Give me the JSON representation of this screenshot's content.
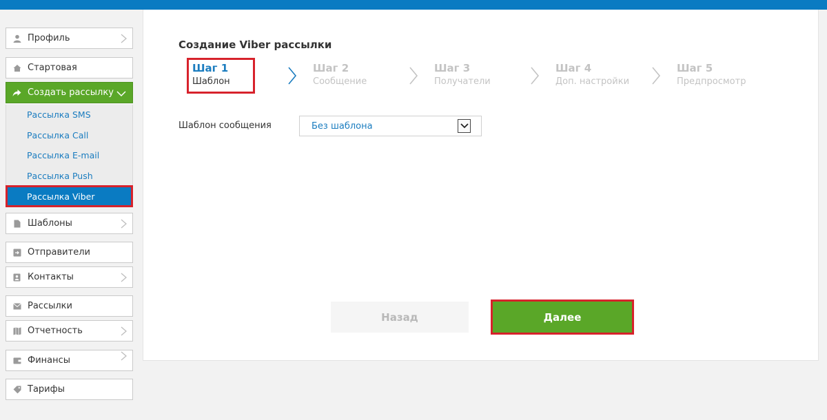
{
  "sidebar": {
    "profile": "Профиль",
    "home": "Стартовая",
    "create": "Создать рассылку",
    "sub": [
      "Рассылка SMS",
      "Рассылка Call",
      "Рассылка E-mail",
      "Рассылка Push",
      "Рассылка Viber"
    ],
    "templates": "Шаблоны",
    "senders": "Отправители",
    "contacts": "Контакты",
    "mailings": "Рассылки",
    "reports": "Отчетность",
    "finance": "Финансы",
    "tariffs": "Тарифы"
  },
  "main": {
    "title": "Создание Viber рассылки",
    "steps": [
      {
        "title": "Шаг 1",
        "sub": "Шаблон"
      },
      {
        "title": "Шаг 2",
        "sub": "Сообщение"
      },
      {
        "title": "Шаг 3",
        "sub": "Получатели"
      },
      {
        "title": "Шаг 4",
        "sub": "Доп. настройки"
      },
      {
        "title": "Шаг 5",
        "sub": "Предпросмотр"
      }
    ],
    "template_label": "Шаблон сообщения",
    "template_value": "Без шаблона",
    "back": "Назад",
    "next": "Далее"
  },
  "colors": {
    "accent_blue": "#0a7bc2",
    "green": "#5aa728",
    "highlight_red": "#d7222b"
  }
}
